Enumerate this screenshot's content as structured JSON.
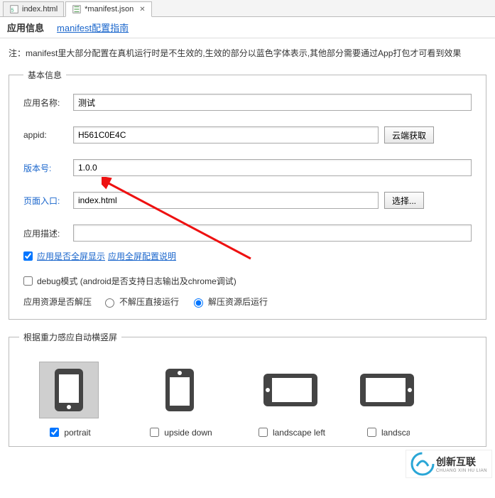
{
  "tabs": {
    "index": "index.html",
    "manifest": "*manifest.json"
  },
  "subnav": {
    "appinfo": "应用信息",
    "guide": "manifest配置指南"
  },
  "note": "注：manifest里大部分配置在真机运行时是不生效的,生效的部分以蓝色字体表示,其他部分需要通过App打包才可看到效果",
  "basic": {
    "legend": "基本信息",
    "name_label": "应用名称:",
    "name_value": "测试",
    "appid_label": "appid:",
    "appid_value": "H561C0E4C",
    "appid_btn": "云端获取",
    "version_label": "版本号:",
    "version_value": "1.0.0",
    "entry_label": "页面入口:",
    "entry_value": "index.html",
    "entry_btn": "选择...",
    "desc_label": "应用描述:",
    "desc_value": "",
    "fullscreen_chk": "应用是否全屏显示",
    "fullscreen_link": "应用全屏配置说明",
    "debug_chk": "debug模式 (android是否支持日志输出及chrome调试)",
    "resource_label": "应用资源是否解压",
    "resource_opt1": "不解压直接运行",
    "resource_opt2": "解压资源后运行"
  },
  "orient": {
    "legend": "根据重力感应自动横竖屏",
    "portrait": "portrait",
    "upside_down": "upside down",
    "landscape_left": "landscape left",
    "landscape_right": "landscape right"
  },
  "watermark": {
    "brand": "创新互联",
    "sub": "CHUANG XIN HU LIAN"
  }
}
